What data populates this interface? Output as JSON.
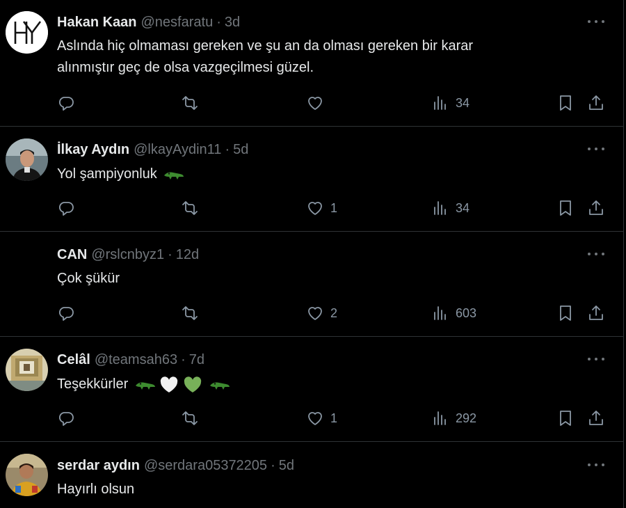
{
  "tweets": [
    {
      "name": "Hakan Kaan",
      "handle": "@nesfaratu",
      "time": "3d",
      "text_line1": "Aslında hiç olmaması gereken ve şu an da olması gereken bir karar",
      "text_line2": "alınmıştır geç de olsa vazgeçilmesi güzel.",
      "likes": "",
      "views": "34",
      "avatar": "HY-logo-avatar"
    },
    {
      "name": "İlkay Aydın",
      "handle": "@lkayAydin11",
      "time": "5d",
      "text": "Yol şampiyonluk",
      "emoji": "crocodile",
      "likes": "1",
      "views": "34",
      "avatar": "photo-avatar"
    },
    {
      "name": "CAN",
      "handle": "@rslcnbyz1",
      "time": "12d",
      "text": "Çok şükür",
      "likes": "2",
      "views": "603",
      "avatar": "none"
    },
    {
      "name": "Celâl",
      "handle": "@teamsah63",
      "time": "7d",
      "text": "Teşekkürler",
      "emoji": "crocodile white-heart green-heart crocodile",
      "likes": "1",
      "views": "292",
      "avatar": "photo-avatar"
    },
    {
      "name": "serdar aydın",
      "handle": "@serdara05372205",
      "time": "5d",
      "text": "Hayırlı olsun",
      "avatar": "photo-avatar"
    }
  ],
  "colors": {
    "background": "#000000",
    "text": "#e7e9ea",
    "muted": "#71767b",
    "divider": "#2f3336",
    "croc": "#3d8b2f",
    "green_heart": "#78b159"
  }
}
